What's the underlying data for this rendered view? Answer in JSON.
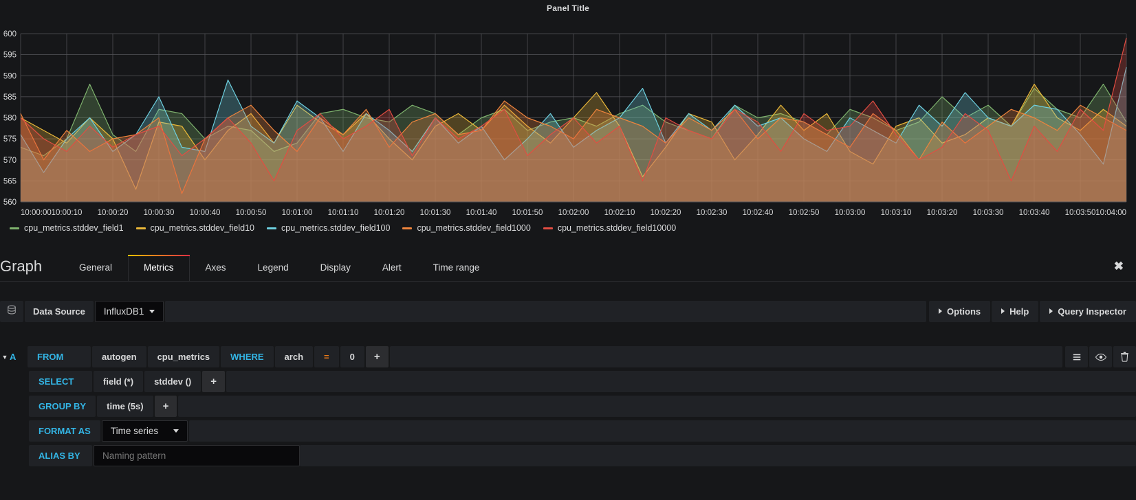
{
  "panel": {
    "title": "Panel Title"
  },
  "chart_data": {
    "type": "line",
    "title": "Panel Title",
    "xlabel": "",
    "ylabel": "",
    "ylim": [
      560,
      600
    ],
    "yticks": [
      560,
      565,
      570,
      575,
      580,
      585,
      590,
      595,
      600
    ],
    "grid": true,
    "legend_position": "bottom",
    "x": [
      "10:00:00",
      "10:00:05",
      "10:00:10",
      "10:00:15",
      "10:00:20",
      "10:00:25",
      "10:00:30",
      "10:00:35",
      "10:00:40",
      "10:00:45",
      "10:00:50",
      "10:00:55",
      "10:01:00",
      "10:01:05",
      "10:01:10",
      "10:01:15",
      "10:01:20",
      "10:01:25",
      "10:01:30",
      "10:01:35",
      "10:01:40",
      "10:01:45",
      "10:01:50",
      "10:01:55",
      "10:02:00",
      "10:02:05",
      "10:02:10",
      "10:02:15",
      "10:02:20",
      "10:02:25",
      "10:02:30",
      "10:02:35",
      "10:02:40",
      "10:02:45",
      "10:02:50",
      "10:02:55",
      "10:03:00",
      "10:03:05",
      "10:03:10",
      "10:03:15",
      "10:03:20",
      "10:03:25",
      "10:03:30",
      "10:03:35",
      "10:03:40",
      "10:03:45",
      "10:03:50",
      "10:03:55",
      "10:04:00"
    ],
    "xticks": [
      "10:00:00",
      "10:00:10",
      "10:00:20",
      "10:00:30",
      "10:00:40",
      "10:00:50",
      "10:01:00",
      "10:01:10",
      "10:01:20",
      "10:01:30",
      "10:01:40",
      "10:01:50",
      "10:02:00",
      "10:02:10",
      "10:02:20",
      "10:02:30",
      "10:02:40",
      "10:02:50",
      "10:03:00",
      "10:03:10",
      "10:03:20",
      "10:03:30",
      "10:03:40",
      "10:03:50",
      "10:04:00"
    ],
    "series": [
      {
        "name": "cpu_metrics.stddev_field1",
        "color": "#7eb26d",
        "values": [
          573,
          571,
          575,
          588,
          576,
          572,
          582,
          581,
          575,
          578,
          577,
          572,
          574,
          581,
          582,
          580,
          579,
          583,
          581,
          576,
          580,
          582,
          577,
          579,
          580,
          578,
          581,
          583,
          579,
          577,
          575,
          583,
          580,
          581,
          579,
          576,
          582,
          580,
          577,
          579,
          585,
          580,
          583,
          578,
          587,
          582,
          580,
          588,
          579
        ]
      },
      {
        "name": "cpu_metrics.stddev_field10",
        "color": "#eab839",
        "values": [
          580,
          577,
          574,
          580,
          575,
          563,
          579,
          578,
          570,
          577,
          581,
          574,
          583,
          579,
          576,
          581,
          575,
          570,
          578,
          581,
          577,
          583,
          578,
          574,
          580,
          586,
          578,
          566,
          573,
          581,
          579,
          570,
          576,
          583,
          577,
          581,
          572,
          569,
          578,
          580,
          574,
          576,
          580,
          578,
          588,
          580,
          577,
          582,
          578
        ]
      },
      {
        "name": "cpu_metrics.stddev_field100",
        "color": "#6ed0e0",
        "values": [
          576,
          567,
          575,
          580,
          572,
          576,
          585,
          573,
          572,
          589,
          578,
          574,
          584,
          580,
          572,
          581,
          577,
          572,
          580,
          574,
          578,
          570,
          575,
          581,
          573,
          577,
          580,
          587,
          574,
          581,
          577,
          583,
          578,
          580,
          575,
          572,
          580,
          577,
          574,
          583,
          578,
          586,
          580,
          578,
          583,
          582,
          576,
          569,
          592
        ]
      },
      {
        "name": "cpu_metrics.stddev_field1000",
        "color": "#ef843c",
        "values": [
          581,
          570,
          577,
          572,
          575,
          576,
          580,
          562,
          575,
          580,
          583,
          577,
          572,
          580,
          576,
          582,
          573,
          579,
          581,
          576,
          577,
          584,
          580,
          578,
          575,
          582,
          580,
          578,
          574,
          580,
          577,
          582,
          575,
          580,
          579,
          576,
          573,
          581,
          577,
          570,
          579,
          574,
          578,
          582,
          580,
          577,
          583,
          580,
          577
        ]
      },
      {
        "name": "cpu_metrics.stddev_field10000",
        "color": "#e24d42",
        "values": [
          580,
          575,
          572,
          578,
          573,
          576,
          578,
          571,
          575,
          580,
          574,
          565,
          577,
          581,
          575,
          578,
          582,
          571,
          580,
          575,
          578,
          582,
          571,
          576,
          580,
          574,
          578,
          565,
          580,
          577,
          575,
          582,
          579,
          572,
          581,
          577,
          578,
          584,
          576,
          570,
          573,
          581,
          577,
          565,
          578,
          572,
          582,
          577,
          599
        ]
      }
    ]
  },
  "editor": {
    "title": "Graph",
    "tabs": [
      {
        "label": "General",
        "active": false
      },
      {
        "label": "Metrics",
        "active": true
      },
      {
        "label": "Axes",
        "active": false
      },
      {
        "label": "Legend",
        "active": false
      },
      {
        "label": "Display",
        "active": false
      },
      {
        "label": "Alert",
        "active": false
      },
      {
        "label": "Time range",
        "active": false
      }
    ],
    "close_label": "✖"
  },
  "datasource": {
    "icon": "database-icon",
    "label": "Data Source",
    "value": "InfluxDB1",
    "buttons": [
      {
        "label": "Options"
      },
      {
        "label": "Help"
      },
      {
        "label": "Query Inspector"
      }
    ]
  },
  "query": {
    "letter": "A",
    "from": {
      "keyword": "FROM",
      "policy": "autogen",
      "measurement": "cpu_metrics",
      "where_keyword": "WHERE",
      "tag_key": "arch",
      "operator": "=",
      "tag_value": "0",
      "add": "+"
    },
    "select": {
      "keyword": "SELECT",
      "parts": [
        "field (*)",
        "stddev ()"
      ],
      "add": "+"
    },
    "group_by": {
      "keyword": "GROUP BY",
      "parts": [
        "time (5s)"
      ],
      "add": "+"
    },
    "format_as": {
      "keyword": "FORMAT AS",
      "value": "Time series"
    },
    "alias_by": {
      "keyword": "ALIAS BY",
      "value": "",
      "placeholder": "Naming pattern"
    },
    "actions": [
      {
        "name": "toggle-edit-mode-icon"
      },
      {
        "name": "eye-icon"
      },
      {
        "name": "trash-icon"
      }
    ]
  }
}
